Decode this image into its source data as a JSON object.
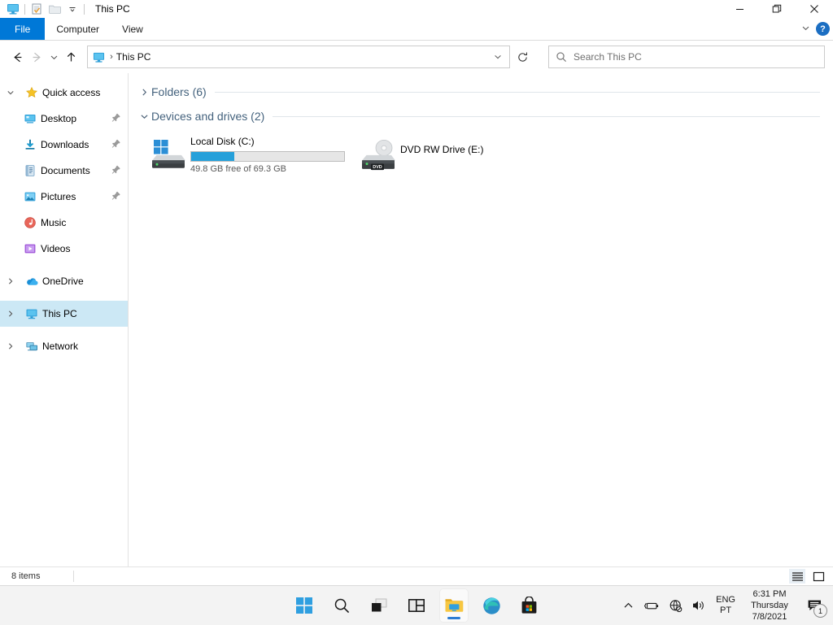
{
  "window": {
    "title": "This PC",
    "quick_access_toolbar": [
      {
        "name": "this-pc-icon",
        "label": "This PC"
      },
      {
        "name": "properties-icon",
        "label": "Properties"
      },
      {
        "name": "new-folder-icon",
        "label": "New folder"
      },
      {
        "name": "customize-chevron-icon",
        "label": "Customize Quick Access Toolbar"
      }
    ],
    "controls": {
      "minimize": "—",
      "restore": "❐",
      "close": "✕"
    }
  },
  "ribbon": {
    "tabs": [
      {
        "label": "File",
        "active": true
      },
      {
        "label": "Computer",
        "active": false
      },
      {
        "label": "View",
        "active": false
      }
    ],
    "expand_label": "⌄",
    "help_label": "?"
  },
  "nav": {
    "back_label": "←",
    "forward_label": "→",
    "recent_label": "⌄",
    "up_label": "↑",
    "address": {
      "icon": "this-pc-icon",
      "crumbs": [
        "This PC"
      ],
      "separator": "›",
      "dropdown_label": "⌄",
      "refresh_label": "↻"
    },
    "search": {
      "placeholder": "Search This PC",
      "value": "",
      "icon": "search-icon"
    }
  },
  "sidebar": {
    "items": [
      {
        "label": "Quick access",
        "icon": "star-icon",
        "expander": "⌄",
        "indent": false,
        "pinned": false,
        "selected": false
      },
      {
        "label": "Desktop",
        "icon": "desktop-icon",
        "expander": "",
        "indent": true,
        "pinned": true,
        "selected": false
      },
      {
        "label": "Downloads",
        "icon": "downloads-icon",
        "expander": "",
        "indent": true,
        "pinned": true,
        "selected": false
      },
      {
        "label": "Documents",
        "icon": "documents-icon",
        "expander": "",
        "indent": true,
        "pinned": true,
        "selected": false
      },
      {
        "label": "Pictures",
        "icon": "pictures-icon",
        "expander": "",
        "indent": true,
        "pinned": true,
        "selected": false
      },
      {
        "label": "Music",
        "icon": "music-icon",
        "expander": "",
        "indent": true,
        "pinned": false,
        "selected": false
      },
      {
        "label": "Videos",
        "icon": "videos-icon",
        "expander": "",
        "indent": true,
        "pinned": false,
        "selected": false
      },
      {
        "label": "OneDrive",
        "icon": "onedrive-icon",
        "expander": "›",
        "indent": false,
        "pinned": false,
        "selected": false
      },
      {
        "label": "This PC",
        "icon": "this-pc-icon",
        "expander": "›",
        "indent": false,
        "pinned": false,
        "selected": true
      },
      {
        "label": "Network",
        "icon": "network-icon",
        "expander": "›",
        "indent": false,
        "pinned": false,
        "selected": false
      }
    ]
  },
  "main": {
    "groups": [
      {
        "label": "Folders (6)",
        "expanded": false,
        "chevron": "›"
      },
      {
        "label": "Devices and drives (2)",
        "expanded": true,
        "chevron": "⌄"
      }
    ],
    "drives": [
      {
        "name": "Local Disk (C:)",
        "icon": "windows-drive-icon",
        "capacity_text": "49.8 GB free of 69.3 GB",
        "free_gb": 49.8,
        "total_gb": 69.3,
        "used_percent": 28,
        "bar_color": "#26a0da",
        "has_bar": true
      },
      {
        "name": "DVD RW Drive (E:)",
        "icon": "dvd-drive-icon",
        "capacity_text": "",
        "has_bar": false,
        "badge": "DVD"
      }
    ]
  },
  "status": {
    "item_count": "8 items",
    "views": [
      {
        "name": "details-view-button",
        "label": "Details view",
        "active": true
      },
      {
        "name": "large-icons-view-button",
        "label": "Large icons view",
        "active": false
      }
    ]
  },
  "taskbar": {
    "items": [
      {
        "name": "start-button",
        "label": "Start",
        "active": false
      },
      {
        "name": "search-button",
        "label": "Search",
        "active": false
      },
      {
        "name": "task-view-button",
        "label": "Task View",
        "active": false
      },
      {
        "name": "widgets-button",
        "label": "Widgets",
        "active": false
      },
      {
        "name": "file-explorer-button",
        "label": "File Explorer",
        "active": true
      },
      {
        "name": "edge-button",
        "label": "Microsoft Edge",
        "active": false
      },
      {
        "name": "microsoft-store-button",
        "label": "Microsoft Store",
        "active": false
      }
    ],
    "tray": {
      "overflow_label": "∧",
      "icons": [
        {
          "name": "battery-icon",
          "label": "Battery"
        },
        {
          "name": "network-globe-icon",
          "label": "Network - no internet"
        },
        {
          "name": "volume-icon",
          "label": "Volume"
        }
      ],
      "language": {
        "line1": "ENG",
        "line2": "PT"
      },
      "clock": {
        "time": "6:31 PM",
        "day": "Thursday",
        "date": "7/8/2021"
      },
      "notifications": {
        "count": "1",
        "label": "Notifications"
      }
    }
  }
}
